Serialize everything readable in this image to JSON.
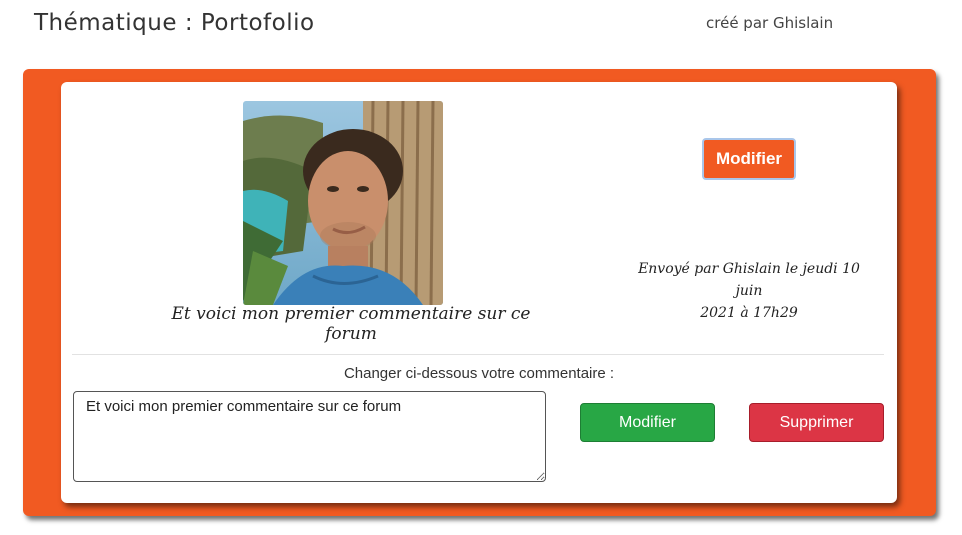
{
  "header": {
    "title": "Thématique : Portofolio",
    "author": "créé par Ghislain"
  },
  "post": {
    "photo_icon": "profile-photo",
    "comment": "Et voici mon premier commentaire sur ce forum",
    "modify_label": "Modifier",
    "sent_by_line1": "Envoyé par Ghislain le jeudi 10 juin",
    "sent_by_line2": "2021 à 17h29"
  },
  "edit": {
    "label": "Changer ci-dessous votre commentaire :",
    "textarea_value": "Et voici mon premier commentaire sur ce forum",
    "modify_label": "Modifier",
    "delete_label": "Supprimer"
  },
  "colors": {
    "accent": "#f15a22",
    "success": "#28a745",
    "danger": "#dc3545"
  }
}
